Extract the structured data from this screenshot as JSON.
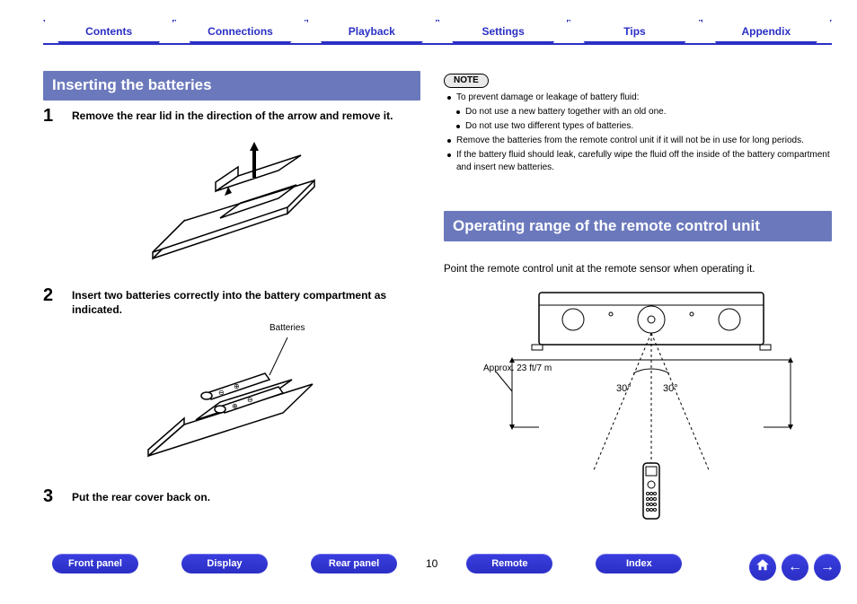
{
  "nav": {
    "tabs": [
      "Contents",
      "Connections",
      "Playback",
      "Settings",
      "Tips",
      "Appendix"
    ]
  },
  "left": {
    "heading": "Inserting the batteries",
    "steps": {
      "n1": "1",
      "t1": "Remove the rear lid in the direction of the arrow and remove it.",
      "n2": "2",
      "t2": "Insert two batteries correctly into the battery compartment as indicated.",
      "n3": "3",
      "t3": "Put the rear cover back on."
    },
    "batteries_label": "Batteries"
  },
  "right": {
    "note_label": "NOTE",
    "note_lead": "To prevent damage or leakage of battery fluid:",
    "note_sub1": "Do not use a new battery together with an old one.",
    "note_sub2": "Do not use two different types of batteries.",
    "note_b2": "Remove the batteries from the remote control unit if it will not be in use for long periods.",
    "note_b3": "If the battery fluid should leak, carefully wipe the fluid off the inside of the battery compartment and insert new batteries.",
    "heading": "Operating range of the remote control unit",
    "body": "Point the remote control unit at the remote sensor when operating it.",
    "distance": "Approx. 23 ft/7 m",
    "angle_left": "30°",
    "angle_right": "30°"
  },
  "bottom": {
    "b1": "Front panel",
    "b2": "Display",
    "b3": "Rear panel",
    "page": "10",
    "b4": "Remote",
    "b5": "Index"
  }
}
